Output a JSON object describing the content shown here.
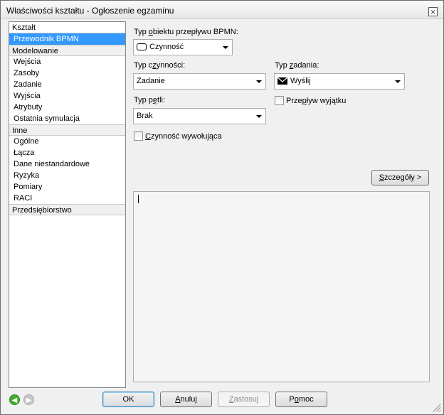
{
  "window": {
    "title": "Właściwości kształtu - Ogłoszenie egzaminu"
  },
  "nav": {
    "groups": [
      {
        "header": "Kształt",
        "items": [
          {
            "label": "Przewodnik BPMN",
            "selected": true
          }
        ]
      },
      {
        "header": "Modelowanie",
        "items": [
          {
            "label": "Wejścia"
          },
          {
            "label": "Zasoby"
          },
          {
            "label": "Zadanie"
          },
          {
            "label": "Wyjścia"
          },
          {
            "label": "Atrybuty"
          },
          {
            "label": "Ostatnia symulacja"
          }
        ]
      },
      {
        "header": "Inne",
        "items": [
          {
            "label": "Ogólne"
          },
          {
            "label": "Łącza"
          },
          {
            "label": "Dane niestandardowe"
          },
          {
            "label": "Ryzyka"
          },
          {
            "label": "Pomiary"
          },
          {
            "label": "RACI"
          }
        ]
      },
      {
        "header": "Przedsiębiorstwo",
        "items": []
      }
    ]
  },
  "form": {
    "flow_type": {
      "label_pre": "Typ ",
      "label_ul": "o",
      "label_post": "biektu przepływu BPMN:",
      "value": "Czynność",
      "icon": "rounded-rect-icon"
    },
    "activity_type": {
      "label_pre": "Typ c",
      "label_ul": "z",
      "label_post": "ynności:",
      "value": "Zadanie"
    },
    "task_type": {
      "label_pre": "Typ ",
      "label_ul": "z",
      "label_post": "adania:",
      "value": "Wyślij",
      "icon": "envelope-icon"
    },
    "loop_type": {
      "label_pre": "Typ p",
      "label_ul": "ę",
      "label_post": "tli:",
      "value": "Brak"
    },
    "exception_flow": {
      "label_pre": "Prze",
      "label_ul": "p",
      "label_post": "ływ wyjątku",
      "checked": false
    },
    "call_activity": {
      "label_pre": "",
      "label_ul": "C",
      "label_post": "zynność wywołująca",
      "checked": false
    },
    "details_button": {
      "label_pre": "",
      "label_ul": "S",
      "label_post": "zczegóły >"
    },
    "description": {
      "value": ""
    }
  },
  "footer": {
    "ok": "OK",
    "cancel_pre": "",
    "cancel_ul": "A",
    "cancel_post": "nuluj",
    "apply_pre": "",
    "apply_ul": "Z",
    "apply_post": "astosuj",
    "help_pre": "P",
    "help_ul": "o",
    "help_post": "moc"
  }
}
